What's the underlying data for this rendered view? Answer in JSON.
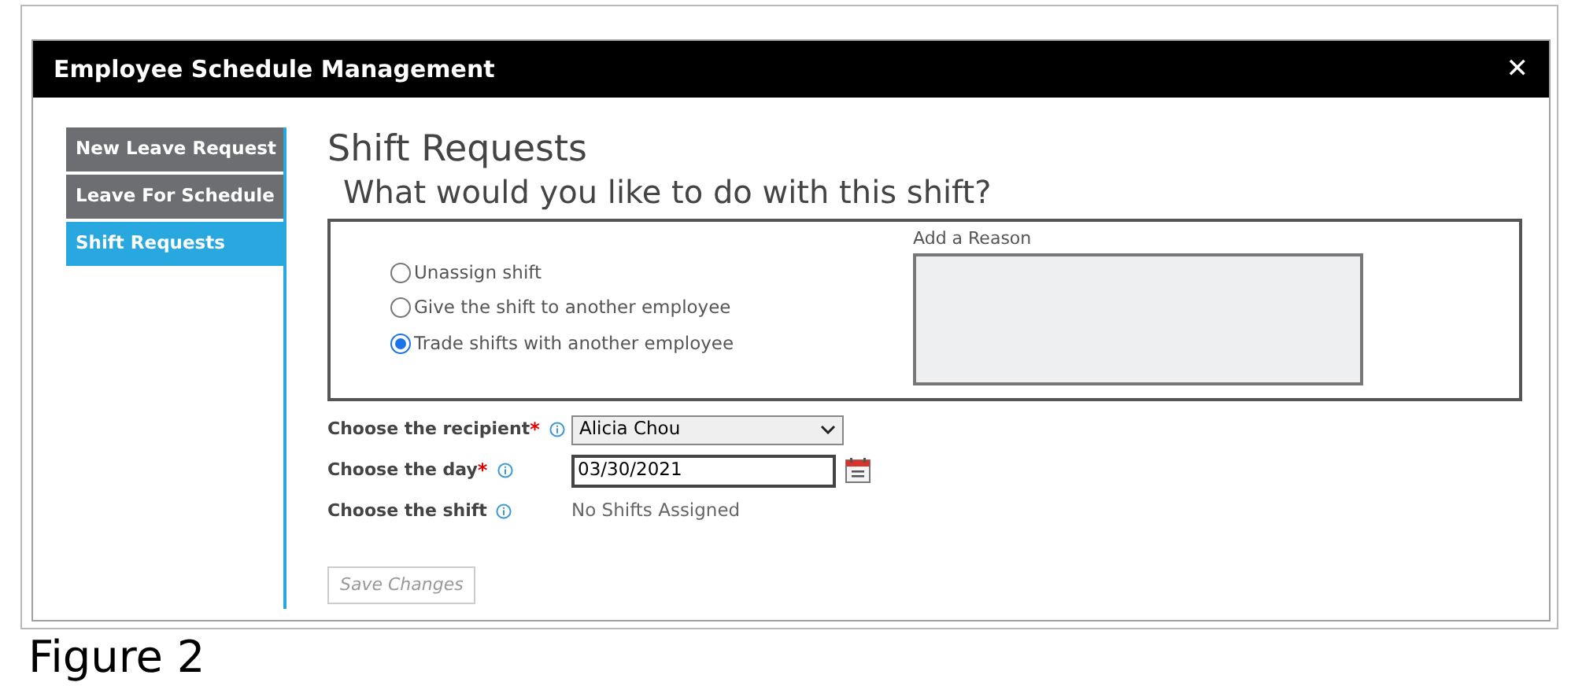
{
  "window": {
    "title": "Employee Schedule Management",
    "close": "✕"
  },
  "sidebar": {
    "items": [
      {
        "label": "New Leave Request",
        "selected": false
      },
      {
        "label": "Leave For Schedule",
        "selected": false
      },
      {
        "label": "Shift Requests",
        "selected": true
      }
    ]
  },
  "heading": "Shift Requests",
  "question": "What would you like to do with this shift?",
  "options": [
    {
      "label": "Unassign shift",
      "selected": false
    },
    {
      "label": "Give the shift to another employee",
      "selected": false
    },
    {
      "label": "Trade shifts with another employee",
      "selected": true
    }
  ],
  "reason": {
    "label": "Add a Reason"
  },
  "fields": [
    {
      "kind": "select",
      "label": "Choose the recipient",
      "required_mark": "*",
      "value": "Alicia Chou"
    },
    {
      "kind": "date",
      "label": "Choose the day",
      "required_mark": "*",
      "value": "03/30/2021"
    },
    {
      "kind": "text",
      "label": "Choose the shift",
      "value": "No Shifts Assigned"
    }
  ],
  "save_button": {
    "label": "Save Changes",
    "disabled": true
  },
  "caption": "Figure 2"
}
